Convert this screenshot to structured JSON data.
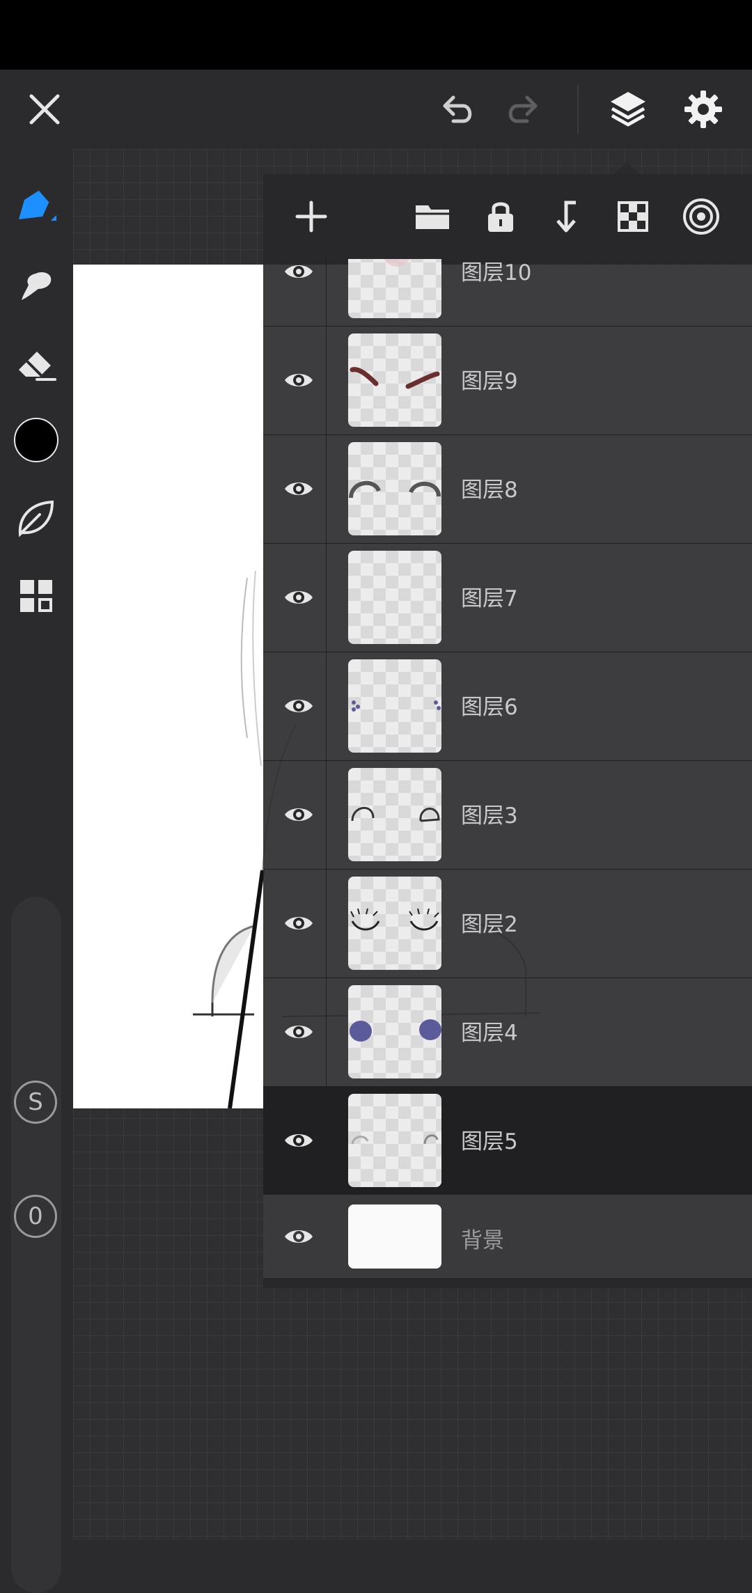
{
  "toolbar": {
    "close": "close-icon",
    "undo": "undo-icon",
    "redo": "redo-icon",
    "layers": "layers-icon",
    "settings": "gear-icon"
  },
  "tools": [
    "brush",
    "smudge",
    "eraser",
    "color",
    "leaf",
    "gallery"
  ],
  "current_color": "#000000",
  "size_slider": {
    "label": "S"
  },
  "opacity_slider": {
    "label": "0"
  },
  "layers_panel": {
    "header_buttons": [
      "add",
      "folder",
      "lock",
      "merge-down",
      "transparency",
      "reference"
    ],
    "layers": [
      {
        "name": "图层10",
        "visible": true
      },
      {
        "name": "图层9",
        "visible": true
      },
      {
        "name": "图层8",
        "visible": true
      },
      {
        "name": "图层7",
        "visible": true
      },
      {
        "name": "图层6",
        "visible": true
      },
      {
        "name": "图层3",
        "visible": true
      },
      {
        "name": "图层2",
        "visible": true
      },
      {
        "name": "图层4",
        "visible": true
      },
      {
        "name": "图层5",
        "visible": true,
        "selected": true
      },
      {
        "name": "背景",
        "visible": true
      }
    ]
  },
  "colors": {
    "accent": "#1e8fff",
    "panel_bg": "#28282b",
    "canvas_bg": "#2f2f31"
  }
}
